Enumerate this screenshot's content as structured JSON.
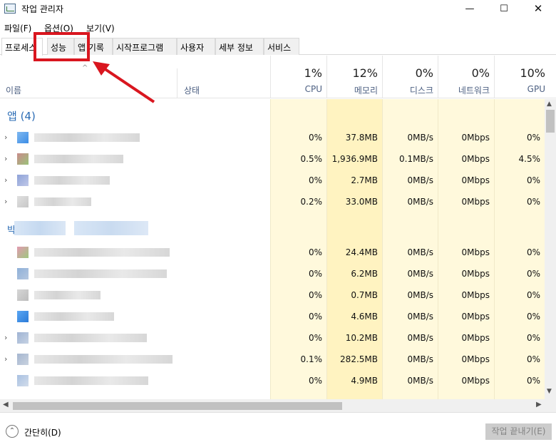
{
  "window": {
    "title": "작업 관리자",
    "minimize_glyph": "—",
    "maximize_glyph": "☐",
    "close_glyph": "✕"
  },
  "menu": [
    {
      "label": "파일(F)"
    },
    {
      "label": "옵션(O)"
    },
    {
      "label": "보기(V)"
    }
  ],
  "tabs": [
    {
      "label": "프로세스",
      "active": true
    },
    {
      "label": "성능"
    },
    {
      "label": "앱 기록"
    },
    {
      "label": "시작프로그램"
    },
    {
      "label": "사용자"
    },
    {
      "label": "세부 정보"
    },
    {
      "label": "서비스"
    }
  ],
  "header": {
    "sort_glyph": "^",
    "name_label": "이름",
    "status_label": "상태",
    "metrics": [
      {
        "pct": "1%",
        "label": "CPU"
      },
      {
        "pct": "12%",
        "label": "메모리"
      },
      {
        "pct": "0%",
        "label": "디스크"
      },
      {
        "pct": "0%",
        "label": "네트워크"
      },
      {
        "pct": "10%",
        "label": "GPU"
      }
    ]
  },
  "groups": {
    "apps_title": "앱 (4)",
    "background_title_visible": "박"
  },
  "rows": [
    {
      "cpu": "0%",
      "mem": "37.8MB",
      "disk": "0MB/s",
      "net": "0Mbps",
      "gpu": "0%",
      "expandable": true
    },
    {
      "cpu": "0.5%",
      "mem": "1,936.9MB",
      "disk": "0.1MB/s",
      "net": "0Mbps",
      "gpu": "4.5%",
      "expandable": true
    },
    {
      "cpu": "0%",
      "mem": "2.7MB",
      "disk": "0MB/s",
      "net": "0Mbps",
      "gpu": "0%",
      "expandable": true
    },
    {
      "cpu": "0.2%",
      "mem": "33.0MB",
      "disk": "0MB/s",
      "net": "0Mbps",
      "gpu": "0%",
      "expandable": true
    },
    {
      "cpu": "0%",
      "mem": "24.4MB",
      "disk": "0MB/s",
      "net": "0Mbps",
      "gpu": "0%",
      "expandable": false
    },
    {
      "cpu": "0%",
      "mem": "6.2MB",
      "disk": "0MB/s",
      "net": "0Mbps",
      "gpu": "0%",
      "expandable": false
    },
    {
      "cpu": "0%",
      "mem": "0.7MB",
      "disk": "0MB/s",
      "net": "0Mbps",
      "gpu": "0%",
      "expandable": false
    },
    {
      "cpu": "0%",
      "mem": "4.6MB",
      "disk": "0MB/s",
      "net": "0Mbps",
      "gpu": "0%",
      "expandable": false
    },
    {
      "cpu": "0%",
      "mem": "10.2MB",
      "disk": "0MB/s",
      "net": "0Mbps",
      "gpu": "0%",
      "expandable": true
    },
    {
      "cpu": "0.1%",
      "mem": "282.5MB",
      "disk": "0MB/s",
      "net": "0Mbps",
      "gpu": "0%",
      "expandable": true
    },
    {
      "cpu": "0%",
      "mem": "4.9MB",
      "disk": "0MB/s",
      "net": "0Mbps",
      "gpu": "0%",
      "expandable": false
    }
  ],
  "footer": {
    "fewer_details": "간단히(D)",
    "end_task": "작업 끝내기(E)"
  },
  "colors": {
    "accent_blue": "#2b6cb5",
    "metric_bg": "#fff9dc",
    "metric_bg_strong": "#fff3c1",
    "annotation_red": "#d9161f"
  }
}
